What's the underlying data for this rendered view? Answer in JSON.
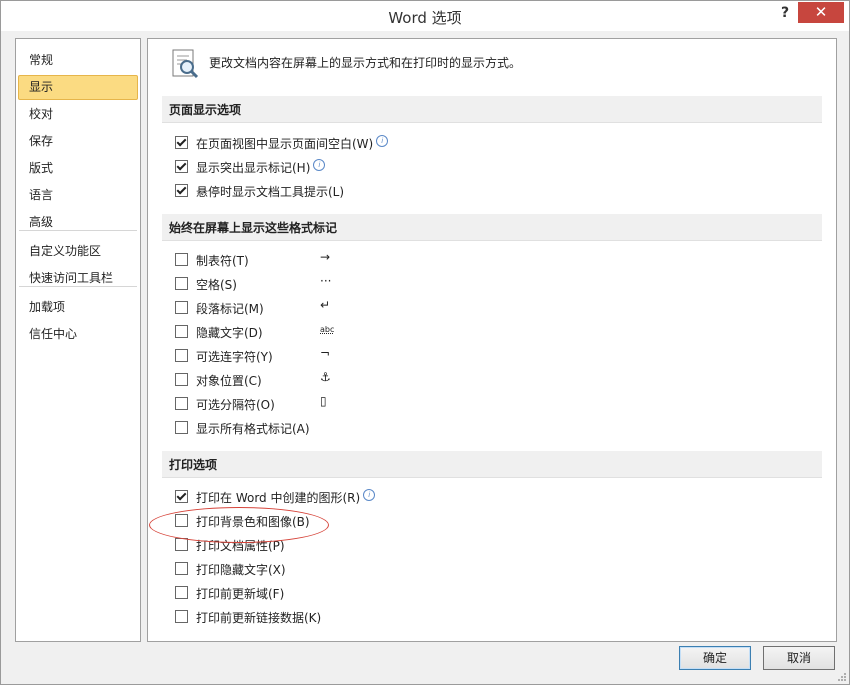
{
  "window": {
    "title": "Word 选项",
    "help_glyph": "?",
    "close_glyph": "✕"
  },
  "nav": {
    "items": [
      {
        "label": "常规",
        "selected": false
      },
      {
        "label": "显示",
        "selected": true
      },
      {
        "label": "校对",
        "selected": false
      },
      {
        "label": "保存",
        "selected": false
      },
      {
        "label": "版式",
        "selected": false
      },
      {
        "label": "语言",
        "selected": false
      },
      {
        "label": "高级",
        "selected": false
      },
      {
        "label": "自定义功能区",
        "selected": false
      },
      {
        "label": "快速访问工具栏",
        "selected": false
      },
      {
        "label": "加载项",
        "selected": false
      },
      {
        "label": "信任中心",
        "selected": false
      }
    ]
  },
  "header": {
    "text": "更改文档内容在屏幕上的显示方式和在打印时的显示方式。",
    "icon": "magnifier-document-icon"
  },
  "sections": [
    {
      "title": "页面显示选项",
      "options": [
        {
          "label": "在页面视图中显示页面间空白(W)",
          "checked": true,
          "info": true
        },
        {
          "label": "显示突出显示标记(H)",
          "checked": true,
          "info": true
        },
        {
          "label": "悬停时显示文档工具提示(L)",
          "checked": true,
          "info": false
        }
      ]
    },
    {
      "title": "始终在屏幕上显示这些格式标记",
      "options": [
        {
          "label": "制表符(T)",
          "checked": false,
          "glyph": "→"
        },
        {
          "label": "空格(S)",
          "checked": false,
          "glyph": "···"
        },
        {
          "label": "段落标记(M)",
          "checked": false,
          "glyph": "↵"
        },
        {
          "label": "隐藏文字(D)",
          "checked": false,
          "glyph": "abc"
        },
        {
          "label": "可选连字符(Y)",
          "checked": false,
          "glyph": "¬"
        },
        {
          "label": "对象位置(C)",
          "checked": false,
          "glyph": "⚓"
        },
        {
          "label": "可选分隔符(O)",
          "checked": false,
          "glyph": "▯"
        },
        {
          "label": "显示所有格式标记(A)",
          "checked": false
        }
      ]
    },
    {
      "title": "打印选项",
      "options": [
        {
          "label": "打印在 Word 中创建的图形(R)",
          "checked": true,
          "info": true
        },
        {
          "label": "打印背景色和图像(B)",
          "checked": false,
          "highlighted": true
        },
        {
          "label": "打印文档属性(P)",
          "checked": false
        },
        {
          "label": "打印隐藏文字(X)",
          "checked": false
        },
        {
          "label": "打印前更新域(F)",
          "checked": false
        },
        {
          "label": "打印前更新链接数据(K)",
          "checked": false
        }
      ]
    }
  ],
  "buttons": {
    "ok": "确定",
    "cancel": "取消"
  },
  "colors": {
    "selected_nav_bg": "#fbdb82",
    "annotation_ellipse": "#d6443a",
    "close_button": "#c7463e"
  }
}
